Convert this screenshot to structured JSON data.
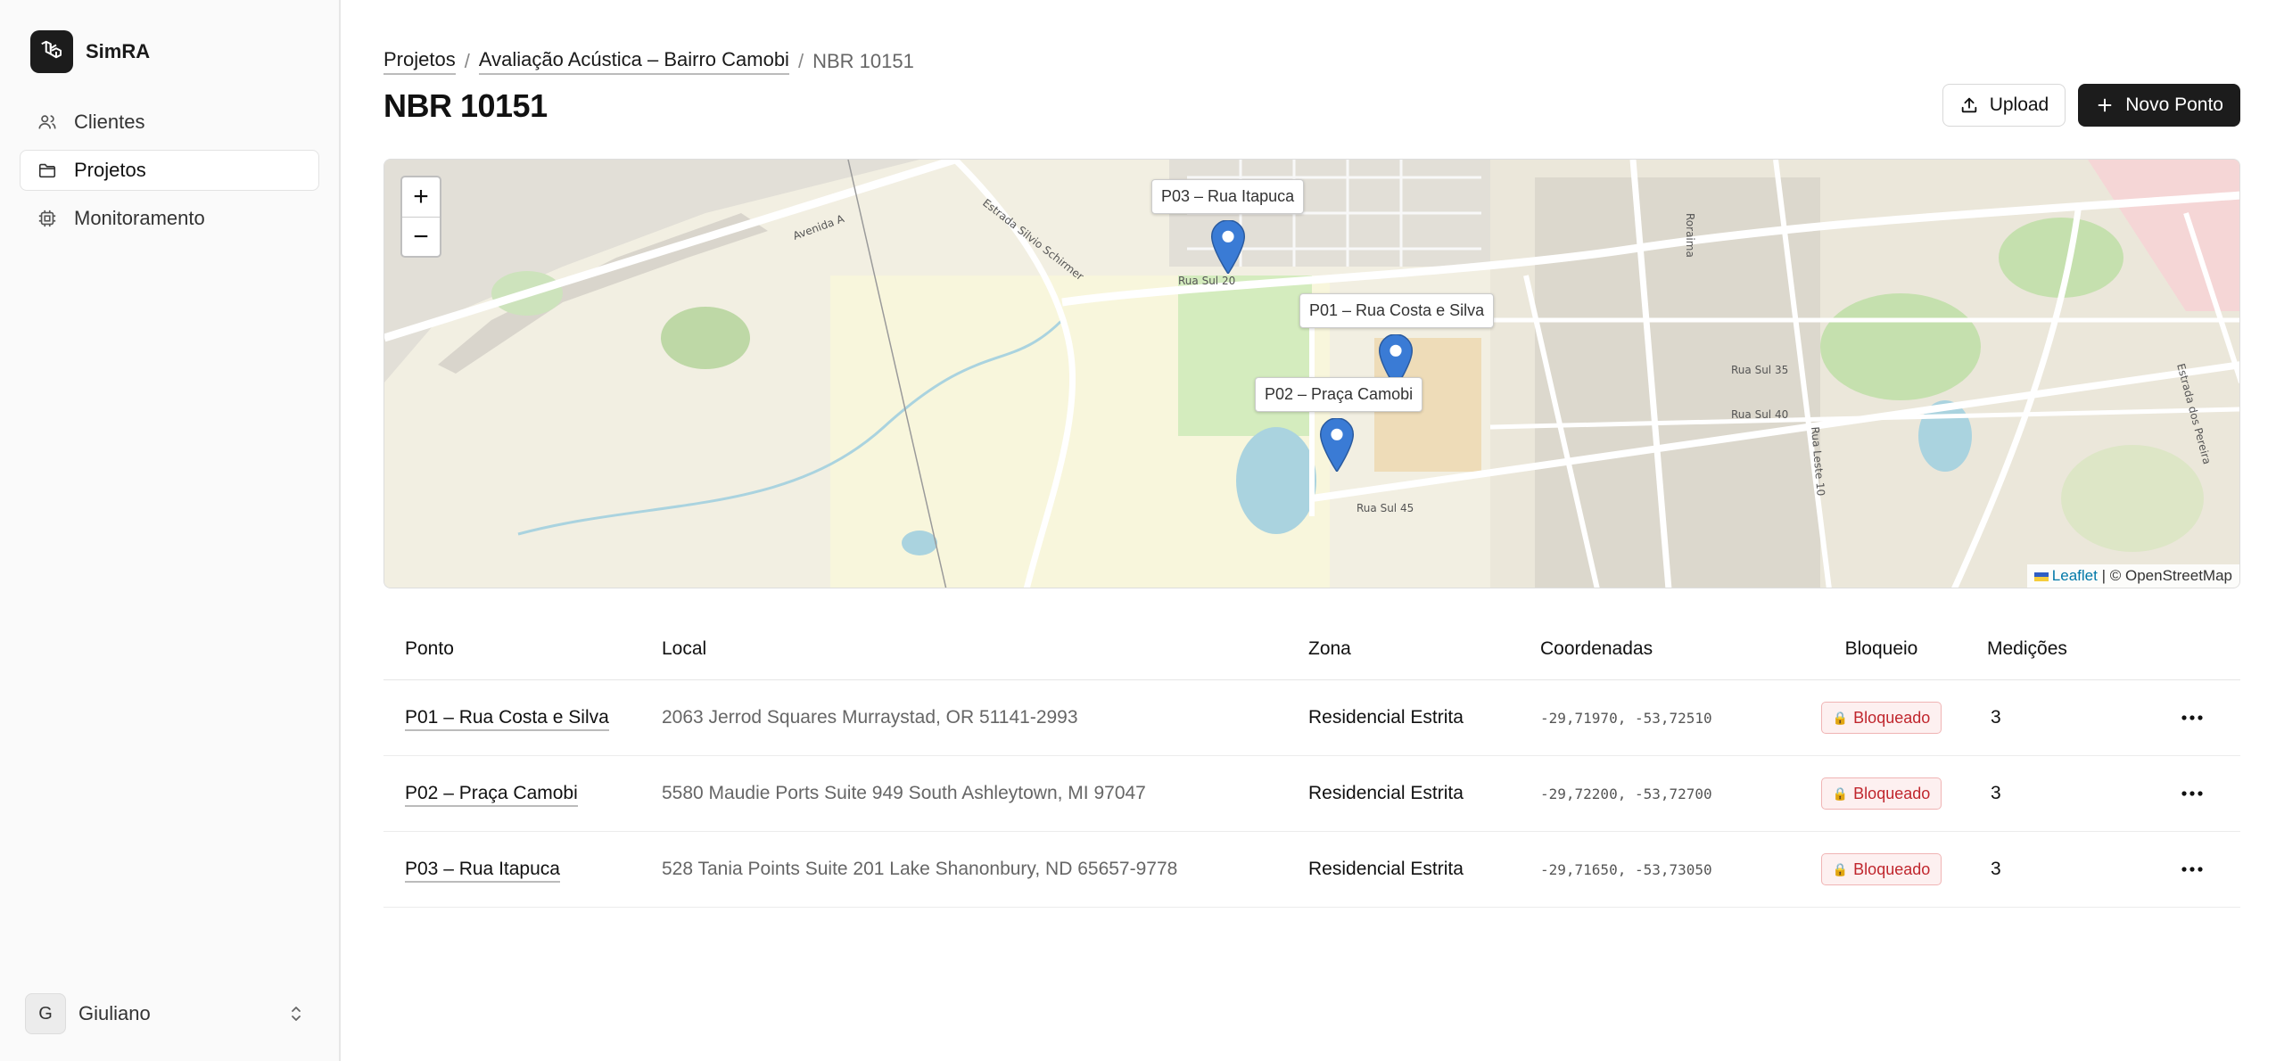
{
  "app": {
    "name": "SimRA"
  },
  "sidebar": {
    "items": [
      {
        "label": "Clientes",
        "icon": "users-icon",
        "active": false
      },
      {
        "label": "Projetos",
        "icon": "folder-icon",
        "active": true
      },
      {
        "label": "Monitoramento",
        "icon": "chip-icon",
        "active": false
      }
    ],
    "user": {
      "initial": "G",
      "name": "Giuliano"
    }
  },
  "breadcrumb": {
    "items": [
      "Projetos",
      "Avaliação Acústica – Bairro Camobi"
    ],
    "separator": "/",
    "current": "NBR 10151"
  },
  "page": {
    "title": "NBR 10151"
  },
  "actions": {
    "upload_label": "Upload",
    "new_point_label": "Novo Ponto"
  },
  "map": {
    "zoom_in": "+",
    "zoom_out": "−",
    "markers": [
      {
        "label": "P03 – Rua Itapuca"
      },
      {
        "label": "P01 – Rua Costa e Silva"
      },
      {
        "label": "P02 – Praça Camobi"
      }
    ],
    "street_labels": [
      "Avenida A",
      "Rua Sul 20",
      "Estrada Silvio Schirmer",
      "Rua Sul 35",
      "Rua Sul 40",
      "Rua Sul 45",
      "Roraima",
      "Rua Leste 10",
      "Estrada dos Pereira"
    ],
    "attribution": {
      "leaflet": "Leaflet",
      "separator": "|",
      "osm": "© OpenStreetMap"
    }
  },
  "table": {
    "headers": [
      "Ponto",
      "Local",
      "Zona",
      "Coordenadas",
      "Bloqueio",
      "Medições"
    ],
    "rows": [
      {
        "ponto": "P01 – Rua Costa e Silva",
        "local": "2063 Jerrod Squares Murraystad, OR 51141-2993",
        "zona": "Residencial Estrita",
        "coords": "-29,71970, -53,72510",
        "bloqueio": "Bloqueado",
        "medicoes": "3"
      },
      {
        "ponto": "P02 – Praça Camobi",
        "local": "5580 Maudie Ports Suite 949 South Ashleytown, MI 97047",
        "zona": "Residencial Estrita",
        "coords": "-29,72200, -53,72700",
        "bloqueio": "Bloqueado",
        "medicoes": "3"
      },
      {
        "ponto": "P03 – Rua Itapuca",
        "local": "528 Tania Points Suite 201 Lake Shanonbury, ND 65657-9778",
        "zona": "Residencial Estrita",
        "coords": "-29,71650, -53,73050",
        "bloqueio": "Bloqueado",
        "medicoes": "3"
      }
    ]
  },
  "colors": {
    "primary": "#1c1c1c",
    "danger": "#c0262d",
    "marker": "#3a7bd5"
  }
}
